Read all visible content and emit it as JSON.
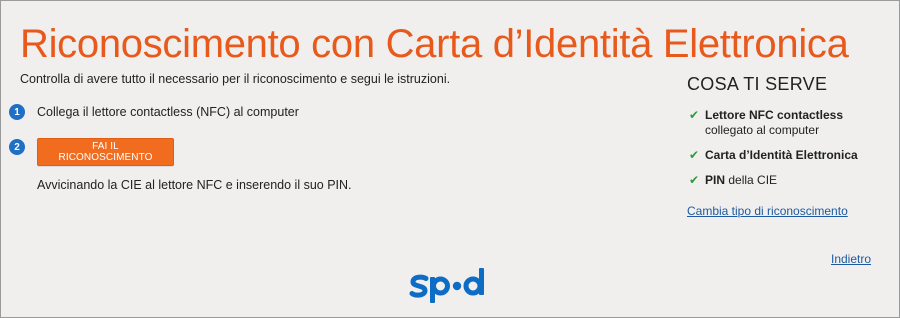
{
  "page": {
    "title": "Riconoscimento con Carta d’Identità Elettronica",
    "intro": "Controlla di avere tutto il necessario per il riconoscimento e segui le istruzioni."
  },
  "steps": [
    {
      "number": "1",
      "text": "Collega il lettore contactless (NFC) al computer"
    },
    {
      "number": "2",
      "button_label": "FAI IL RICONOSCIMENTO",
      "text": "Avvicinando la CIE al lettore NFC e inserendo il suo PIN."
    }
  ],
  "sidebar": {
    "title": "COSA TI SERVE",
    "items": [
      {
        "bold": "Lettore NFC contactless",
        "rest": " collegato al computer"
      },
      {
        "bold": "Carta d’Identità Elettronica",
        "rest": ""
      },
      {
        "bold": "PIN",
        "rest": " della CIE"
      }
    ],
    "change_link": "Cambia tipo di riconoscimento"
  },
  "footer": {
    "back_link": "Indietro",
    "logo_text": "spid"
  },
  "colors": {
    "accent": "#e8591c",
    "button": "#f26c1f",
    "step_badge": "#1f6fc5",
    "link": "#1f5aa0",
    "check": "#2a9d3a",
    "logo": "#0d6dc4"
  }
}
